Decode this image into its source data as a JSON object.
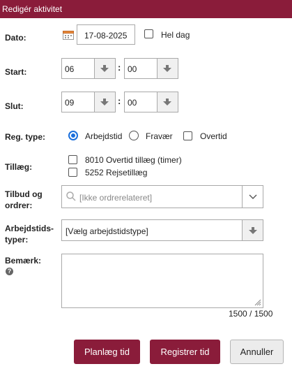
{
  "dialog": {
    "title": "Redigér aktivitet"
  },
  "date": {
    "label": "Dato:",
    "value": "17-08-2025",
    "all_day_label": "Hel dag",
    "all_day_checked": false,
    "icon": "calendar-icon"
  },
  "start": {
    "label": "Start:",
    "hour": "06",
    "minute": "00",
    "separator": ":"
  },
  "end": {
    "label": "Slut:",
    "hour": "09",
    "minute": "00",
    "separator": ":"
  },
  "reg_type": {
    "label": "Reg. type:",
    "options": [
      "Arbejdstid",
      "Fravær",
      "Overtid"
    ],
    "selected": "Arbejdstid"
  },
  "supplements": {
    "label": "Tillæg:",
    "items": [
      "8010 Overtid tillæg (timer)",
      "5252 Rejsetillæg"
    ]
  },
  "orders": {
    "label_line1": "Tilbud og",
    "label_line2": "ordrer:",
    "placeholder": "[Ikke ordrerelateret]"
  },
  "worktime_types": {
    "label_line1": "Arbejdstids-",
    "label_line2": "typer:",
    "value": "[Vælg arbejdstidstype]"
  },
  "remark": {
    "label": "Bemærk:",
    "help_symbol": "?",
    "counter": "1500 / 1500"
  },
  "buttons": {
    "plan": "Planlæg tid",
    "register": "Registrer tid",
    "cancel": "Annuller"
  },
  "colors": {
    "primary": "#8a1c3a",
    "radio_accent": "#1a6fdc"
  }
}
